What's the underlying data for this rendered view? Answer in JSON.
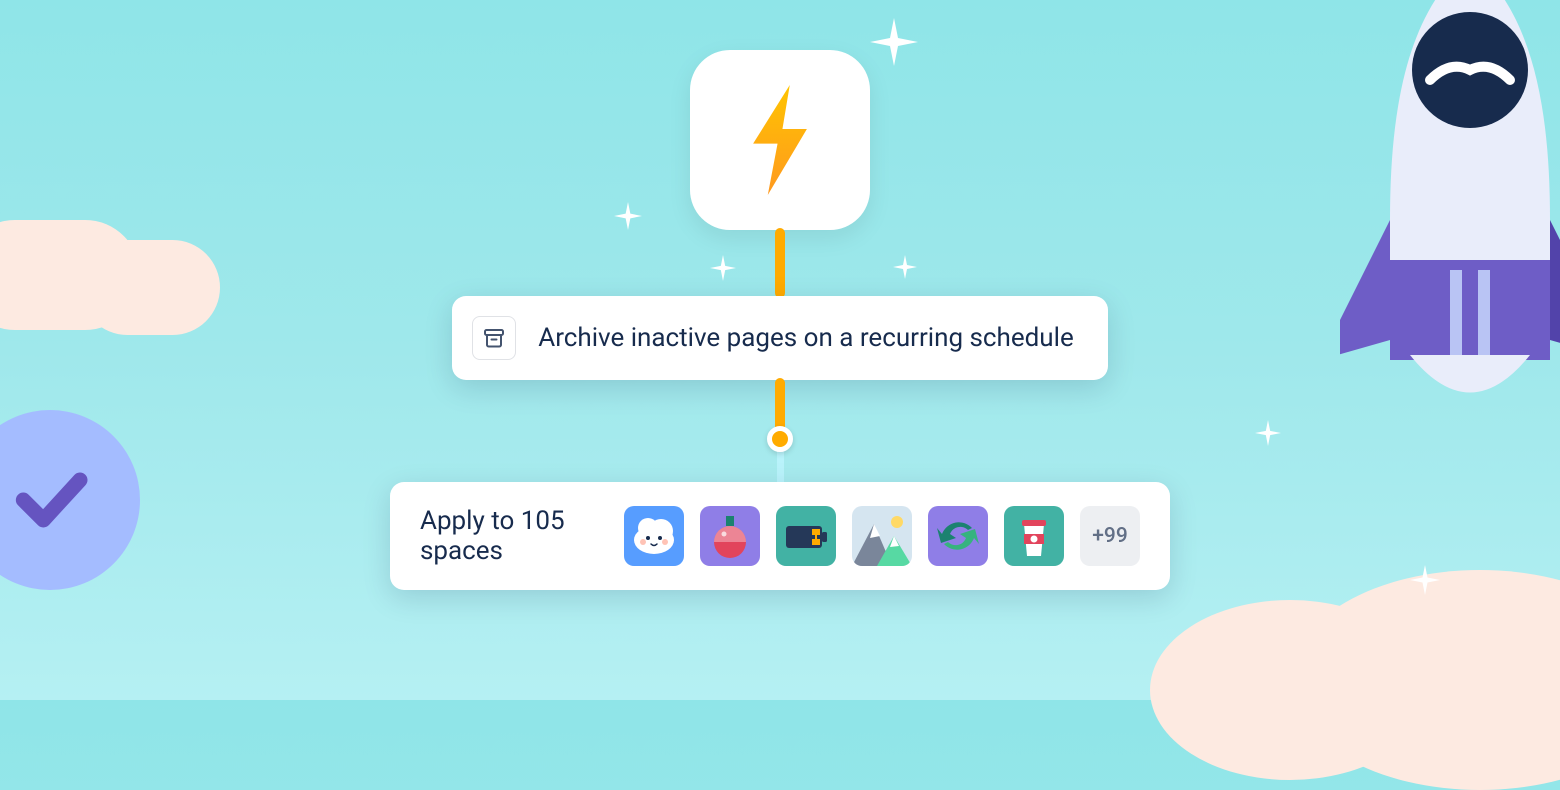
{
  "automation": {
    "trigger_icon": "lightning-bolt",
    "action": {
      "icon": "archive",
      "label": "Archive inactive pages on a recurring schedule"
    },
    "apply": {
      "label": "Apply to 105 spaces",
      "space_count": 105,
      "spaces": [
        {
          "name": "cloud",
          "bg": "#579DFF"
        },
        {
          "name": "potion",
          "bg": "#8F7EE7"
        },
        {
          "name": "battery",
          "bg": "#42B2A4"
        },
        {
          "name": "mountain",
          "bg": "#D5E5F0"
        },
        {
          "name": "sync",
          "bg": "#8F7EE7"
        },
        {
          "name": "coffee",
          "bg": "#42B2A4"
        }
      ],
      "more": "+99"
    }
  },
  "decoration": {
    "rocket": "rocket",
    "checkmark": "checkmark",
    "colors": {
      "accent": "#FFAB00",
      "text": "#172B4D"
    }
  }
}
